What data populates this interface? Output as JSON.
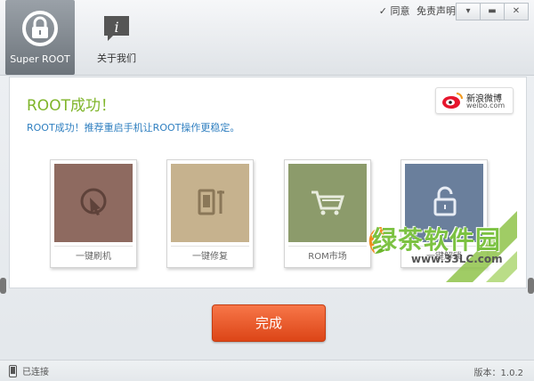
{
  "window": {
    "agree_label": "同意",
    "disclaimer_label": "免责声明",
    "buttons": [
      "minimize-icon",
      "restore-icon",
      "close-icon"
    ]
  },
  "tabs": [
    {
      "label": "Super ROOT",
      "icon": "lock-refresh-icon",
      "active": true
    },
    {
      "label": "关于我们",
      "icon": "info-bubble-icon",
      "active": false
    }
  ],
  "main": {
    "title": "ROOT成功！",
    "subtitle": "ROOT成功！推荐重启手机让ROOT操作更稳定。",
    "weibo": {
      "name": "新浪微博",
      "domain": "weibo.com"
    }
  },
  "cards": [
    {
      "label": "一键刷机",
      "color": "#8e6a60",
      "icon": "flash-icon"
    },
    {
      "label": "一键修复",
      "color": "#c6b28e",
      "icon": "repair-icon"
    },
    {
      "label": "ROM市场",
      "color": "#8c9b6b",
      "icon": "cart-icon"
    },
    {
      "label": "一键解锁",
      "color": "#6a7f9c",
      "icon": "unlock-icon"
    }
  ],
  "watermark": {
    "name": "绿茶软件园",
    "url": "www.33LC.com"
  },
  "done_button": "完成",
  "status": {
    "connection": "已连接",
    "version": "版本：1.0.2"
  }
}
